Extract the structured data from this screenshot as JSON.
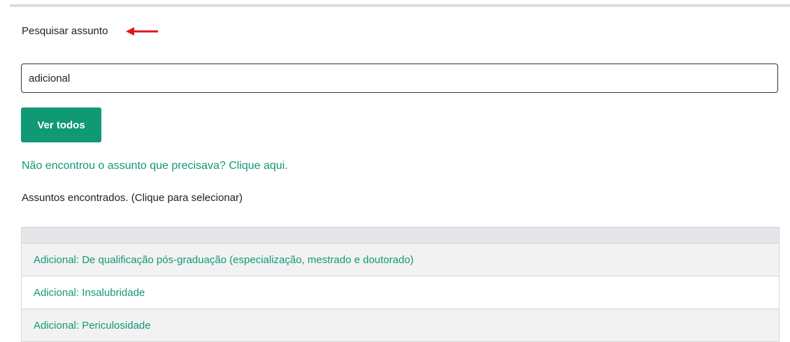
{
  "search": {
    "label": "Pesquisar assunto",
    "value": "adicional"
  },
  "buttons": {
    "ver_todos": "Ver todos"
  },
  "not_found_link": "Não encontrou o assunto que precisava? Clique aqui.",
  "results": {
    "heading": "Assuntos encontrados. (Clique para selecionar)",
    "items": [
      "Adicional: De qualificação pós-graduação (especialização, mestrado e doutorado)",
      "Adicional: Insalubridade",
      "Adicional: Periculosidade"
    ]
  },
  "colors": {
    "accent": "#0f9974",
    "link": "#119878",
    "annotation_arrow": "#e3141b"
  },
  "icons": {
    "annotation": "red-arrow-pointing-left"
  }
}
